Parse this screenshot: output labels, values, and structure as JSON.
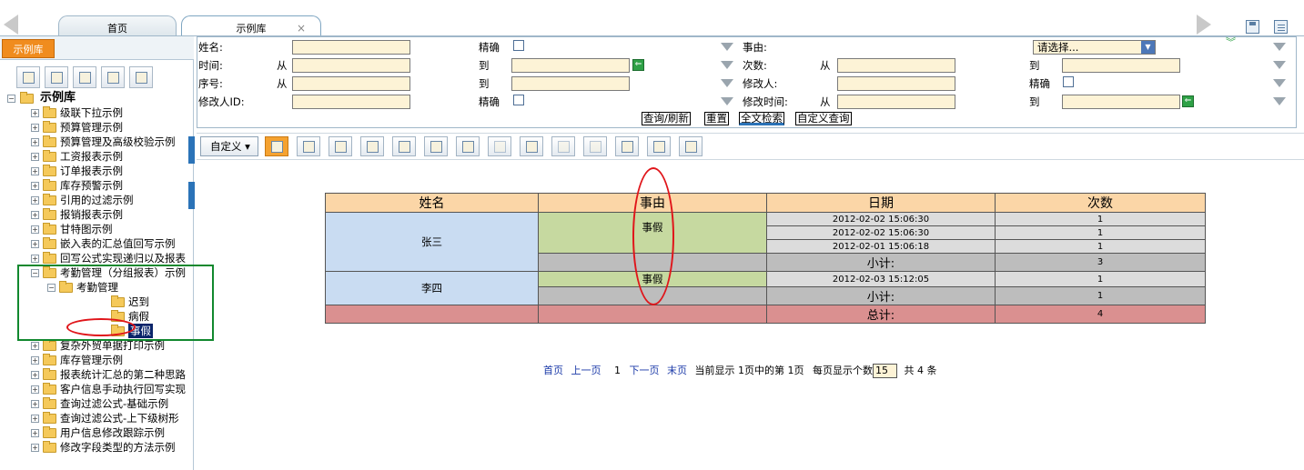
{
  "tabs": {
    "home": "首页",
    "library": "示例库",
    "close": "×"
  },
  "sidebar": {
    "tab_label": "示例库",
    "root": "示例库",
    "items": [
      "级联下拉示例",
      "预算管理示例",
      "预算管理及高级校验示例",
      "工资报表示例",
      "订单报表示例",
      "库存预警示例",
      "引用的过滤示例",
      "报销报表示例",
      "甘特图示例",
      "嵌入表的汇总值回写示例",
      "回写公式实现递归以及报表",
      "考勤管理（分组报表）示例",
      "考勤管理",
      "迟到",
      "病假",
      "事假",
      "复杂外贸单据打印示例",
      "库存管理示例",
      "报表统计汇总的第二种思路",
      "客户信息手动执行回写实现",
      "查询过滤公式-基础示例",
      "查询过滤公式-上下级树形",
      "用户信息修改跟踪示例",
      "修改字段类型的方法示例"
    ]
  },
  "filter": {
    "name": "姓名:",
    "exact": "精确",
    "reason": "事由:",
    "reason_select": "请选择...",
    "time": "时间:",
    "from": "从",
    "to": "到",
    "count": "次数:",
    "seq": "序号:",
    "modifier": "修改人:",
    "modifier_id": "修改人ID:",
    "modify_time": "修改时间:",
    "btn_query": "查询/刷新",
    "btn_reset": "重置",
    "btn_fulltext": "全文检索",
    "btn_custom_query": "自定义查询"
  },
  "toolbar": {
    "custom": "自定义 ▾"
  },
  "report": {
    "headers": [
      "姓名",
      "事由",
      "日期",
      "次数"
    ],
    "groups": [
      {
        "name": "张三",
        "reason": "事假",
        "rows": [
          [
            "2012-02-02 15:06:30",
            "1"
          ],
          [
            "2012-02-02 15:06:30",
            "1"
          ],
          [
            "2012-02-01 15:06:18",
            "1"
          ]
        ],
        "subtotal_label": "小计:",
        "subtotal": "3"
      },
      {
        "name": "李四",
        "reason": "事假",
        "rows": [
          [
            "2012-02-03 15:12:05",
            "1"
          ]
        ],
        "subtotal_label": "小计:",
        "subtotal": "1"
      }
    ],
    "total_label": "总计:",
    "total": "4"
  },
  "pager": {
    "first": "首页",
    "prev": "上一页",
    "page": "1",
    "next": "下一页",
    "last": "末页",
    "info": "当前显示 1页中的第 1页",
    "per_page_label": "每页显示个数",
    "per_page": "15",
    "total": "共 4 条"
  },
  "colors": {
    "accent_orange": "#f08c1e",
    "annotation_red": "#e0151a",
    "annotation_green": "#11882e",
    "header_bg": "#fbd6a7"
  }
}
